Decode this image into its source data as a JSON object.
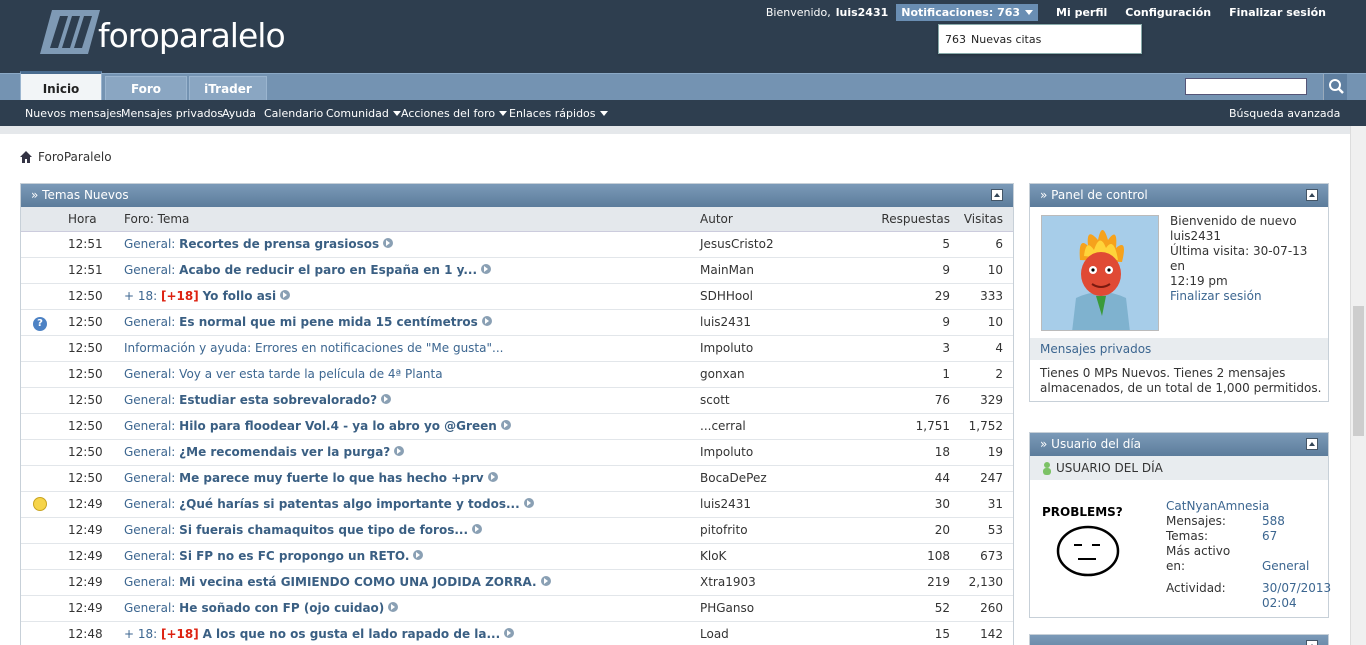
{
  "header": {
    "logo_text": "foroparalelo",
    "welcome_prefix": "Bienvenido,",
    "username": "luis2431",
    "notifications_label": "Notificaciones: 763",
    "links": [
      "Mi perfil",
      "Configuración",
      "Finalizar sesión"
    ],
    "notif_popup": {
      "count": "763",
      "text": "Nuevas citas"
    }
  },
  "tabs": [
    "Inicio",
    "Foro",
    "iTrader"
  ],
  "subnav": {
    "items": [
      "Nuevos mensajes",
      "Mensajes privados",
      "Ayuda",
      "Calendario",
      "Comunidad",
      "Acciones del foro",
      "Enlaces rápidos"
    ],
    "advanced_search": "Búsqueda avanzada"
  },
  "breadcrumb": "ForoParalelo",
  "temas": {
    "title": "» Temas Nuevos",
    "columns": [
      "Hora",
      "Foro: Tema",
      "Autor",
      "Respuestas",
      "Visitas"
    ],
    "rows": [
      {
        "icon": "",
        "hora": "12:51",
        "foro": "General:",
        "tag": "",
        "tema": "Recortes de prensa grasiosos",
        "plain": false,
        "autor": "JesusCristo2",
        "resp": "5",
        "vis": "6"
      },
      {
        "icon": "",
        "hora": "12:51",
        "foro": "General:",
        "tag": "",
        "tema": "Acabo de reducir el paro en España en 1 y...",
        "plain": false,
        "autor": "MainMan",
        "resp": "9",
        "vis": "10"
      },
      {
        "icon": "",
        "hora": "12:50",
        "foro": "+ 18:",
        "tag": "[+18]",
        "tema": "Yo follo asi",
        "plain": false,
        "autor": "SDHHool",
        "resp": "29",
        "vis": "333"
      },
      {
        "icon": "question",
        "hora": "12:50",
        "foro": "General:",
        "tag": "",
        "tema": "Es normal que mi pene mida 15 centímetros",
        "plain": false,
        "autor": "luis2431",
        "resp": "9",
        "vis": "10"
      },
      {
        "icon": "",
        "hora": "12:50",
        "foro": "Información y ayuda:",
        "tag": "",
        "tema": "Errores en notificaciones de \"Me gusta\"...",
        "plain": true,
        "autor": "Impoluto",
        "resp": "3",
        "vis": "4"
      },
      {
        "icon": "",
        "hora": "12:50",
        "foro": "General:",
        "tag": "",
        "tema": "Voy a ver esta tarde la película de 4ª Planta",
        "plain": true,
        "autor": "gonxan",
        "resp": "1",
        "vis": "2"
      },
      {
        "icon": "",
        "hora": "12:50",
        "foro": "General:",
        "tag": "",
        "tema": "Estudiar esta sobrevalorado?",
        "plain": false,
        "autor": "scott",
        "resp": "76",
        "vis": "329"
      },
      {
        "icon": "",
        "hora": "12:50",
        "foro": "General:",
        "tag": "",
        "tema": "Hilo para floodear Vol.4 - ya lo abro yo @Green",
        "plain": false,
        "autor": "...cerral",
        "resp": "1,751",
        "vis": "1,752"
      },
      {
        "icon": "",
        "hora": "12:50",
        "foro": "General:",
        "tag": "",
        "tema": "¿Me recomendais ver la purga?",
        "plain": false,
        "autor": "Impoluto",
        "resp": "18",
        "vis": "19"
      },
      {
        "icon": "",
        "hora": "12:50",
        "foro": "General:",
        "tag": "",
        "tema": "Me parece muy fuerte lo que has hecho +prv",
        "plain": false,
        "autor": "BocaDePez",
        "resp": "44",
        "vis": "247"
      },
      {
        "icon": "bulb",
        "hora": "12:49",
        "foro": "General:",
        "tag": "",
        "tema": "¿Qué harías si patentas algo importante y todos...",
        "plain": false,
        "autor": "luis2431",
        "resp": "30",
        "vis": "31"
      },
      {
        "icon": "",
        "hora": "12:49",
        "foro": "General:",
        "tag": "",
        "tema": "Si fuerais chamaquitos que tipo de foros...",
        "plain": false,
        "autor": "pitofrito",
        "resp": "20",
        "vis": "53"
      },
      {
        "icon": "",
        "hora": "12:49",
        "foro": "General:",
        "tag": "",
        "tema": "Si FP no es FC propongo un RETO.",
        "plain": false,
        "autor": "KloK",
        "resp": "108",
        "vis": "673"
      },
      {
        "icon": "",
        "hora": "12:49",
        "foro": "General:",
        "tag": "",
        "tema": "Mi vecina está GIMIENDO COMO UNA JODIDA ZORRA.",
        "plain": false,
        "autor": "Xtra1903",
        "resp": "219",
        "vis": "2,130"
      },
      {
        "icon": "",
        "hora": "12:49",
        "foro": "General:",
        "tag": "",
        "tema": "He soñado con FP (ojo cuidao)",
        "plain": false,
        "autor": "PHGanso",
        "resp": "52",
        "vis": "260"
      },
      {
        "icon": "",
        "hora": "12:48",
        "foro": "+ 18:",
        "tag": "[+18]",
        "tema": "A los que no os gusta el lado rapado de la...",
        "plain": false,
        "autor": "Load",
        "resp": "15",
        "vis": "142"
      }
    ]
  },
  "panel": {
    "title": "» Panel de control",
    "welcome_lines": [
      "Bienvenido de nuevo",
      "luis2431",
      "Última visita: 30-07-13 en",
      "12:19 pm"
    ],
    "logout": "Finalizar sesión",
    "mp_title": "Mensajes privados",
    "mp_text": "Tienes 0 MPs Nuevos. Tienes 2 mensajes almacenados, de un total de 1,000 permitidos."
  },
  "usuario_dia": {
    "title": "» Usuario del día",
    "subtitle": "USUARIO DEL DÍA",
    "image_text": "PROBLEMS?",
    "user": "CatNyanAmnesia",
    "stats": [
      {
        "label": "Mensajes:",
        "value": "588"
      },
      {
        "label": "Temas:",
        "value": "67"
      },
      {
        "label": "Más activo",
        "value": ""
      },
      {
        "label": "en:",
        "value": "General"
      },
      {
        "label": "",
        "value": ""
      },
      {
        "label": "Actividad:",
        "value": "30/07/2013"
      },
      {
        "label": "",
        "value": "02:04"
      }
    ]
  },
  "colors": {
    "header": "#2e3e4f",
    "tabbar": "#7493b2",
    "link": "#3c6690",
    "tag18": "#dd2211"
  }
}
